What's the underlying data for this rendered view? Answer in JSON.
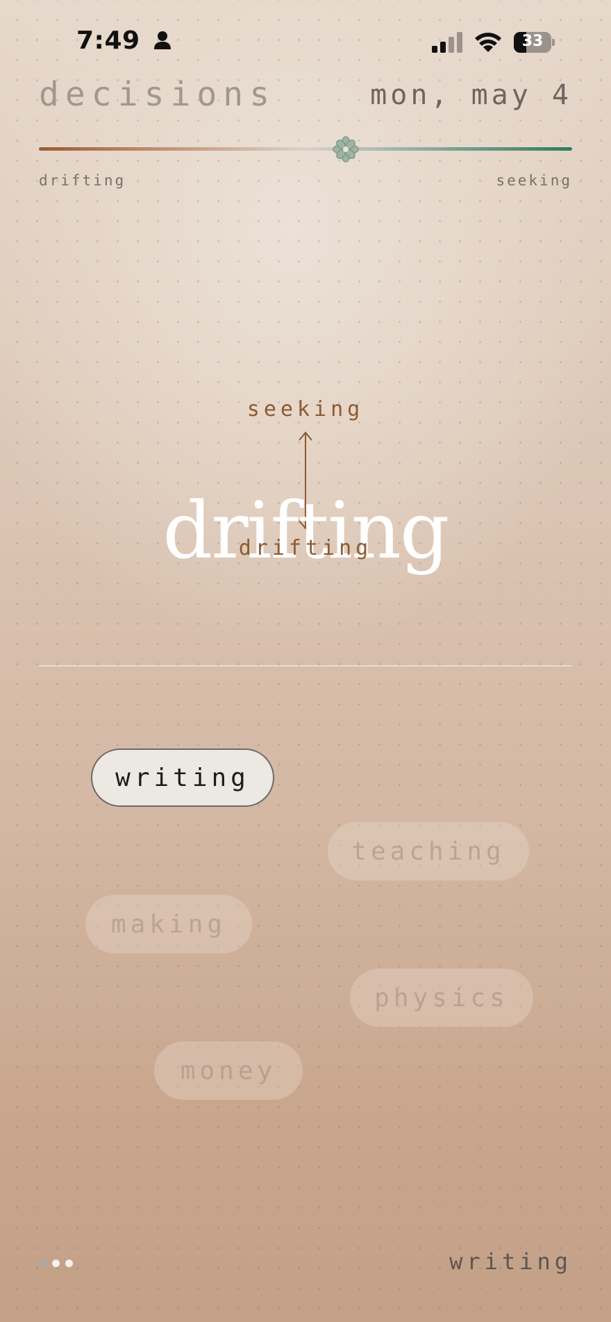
{
  "status_bar": {
    "time": "7:49",
    "person_icon": "person-icon",
    "signal_icon": "cellular-signal-icon",
    "wifi_icon": "wifi-icon",
    "battery_level": "33",
    "battery_icon": "battery-icon"
  },
  "header": {
    "title": "decisions",
    "date": "mon, may 4"
  },
  "slider": {
    "min_label": "drifting",
    "max_label": "seeking",
    "value_fraction": 0.575,
    "thumb_icon": "flower-icon",
    "colors": {
      "start": "#9c5a34",
      "mid": "#d9d2cc",
      "end": "#2f7a62"
    }
  },
  "center": {
    "up_label": "seeking",
    "current": "drifting",
    "down_label": "drifting",
    "arrow_icon": "up-down-arrow-icon"
  },
  "chips": [
    {
      "label": "writing",
      "selected": true
    },
    {
      "label": "teaching",
      "selected": false
    },
    {
      "label": "making",
      "selected": false
    },
    {
      "label": "physics",
      "selected": false
    },
    {
      "label": "money",
      "selected": false
    }
  ],
  "footer": {
    "page_count": 3,
    "current_page": 0,
    "label": "writing"
  }
}
